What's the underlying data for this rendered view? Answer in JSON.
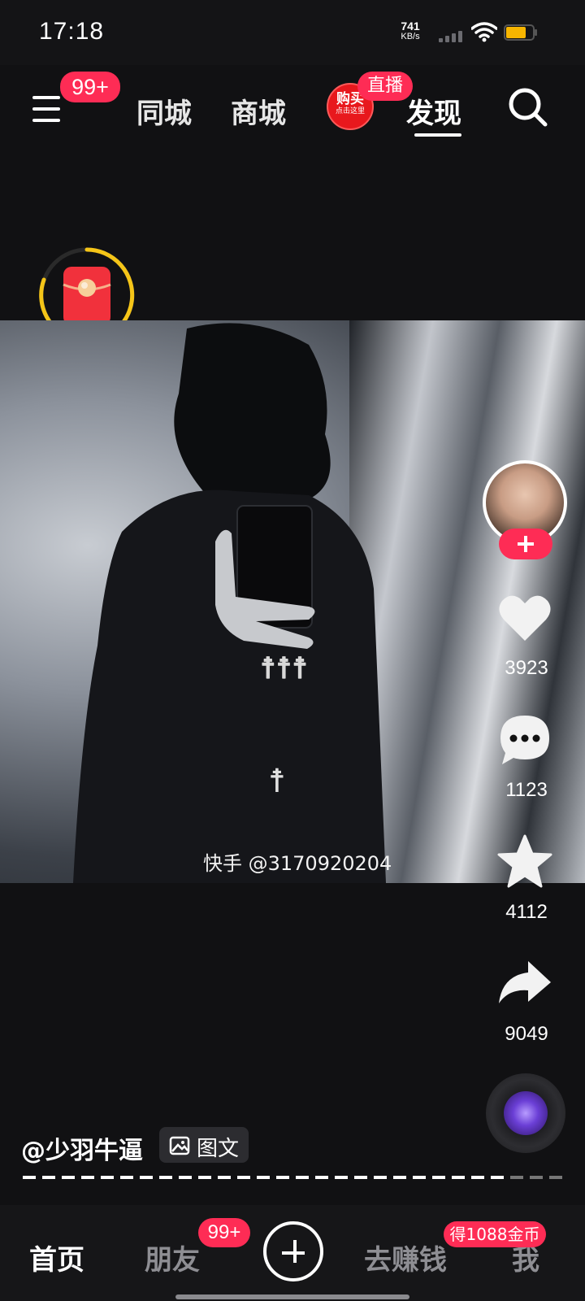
{
  "status_bar": {
    "time": "17:18",
    "net_speed_value": "741",
    "net_speed_unit": "KB/s",
    "battery_level": 0.75,
    "battery_color": "#f7b500"
  },
  "top_nav": {
    "menu_badge": "99+",
    "tabs": [
      {
        "label": "同城"
      },
      {
        "label": "商城"
      },
      {
        "label": "发现"
      }
    ],
    "live_icon_line1": "购买",
    "live_icon_line2": "点击这里",
    "live_tag": "直播",
    "active_tab": "发现"
  },
  "video": {
    "watermark": "快手 @3170920204"
  },
  "actions": {
    "like_count": "3923",
    "comment_count": "1123",
    "favorite_count": "4112",
    "share_count": "9049"
  },
  "author": {
    "name": "@少羽牛逼",
    "content_type": "图文"
  },
  "bottom_nav": {
    "items": [
      {
        "label": "首页"
      },
      {
        "label": "朋友"
      },
      {
        "label": "去赚钱"
      },
      {
        "label": "我"
      }
    ],
    "friends_badge": "99+",
    "coin_badge": "得1088金币"
  },
  "colors": {
    "accent": "#fe2c55",
    "background": "#111113"
  }
}
